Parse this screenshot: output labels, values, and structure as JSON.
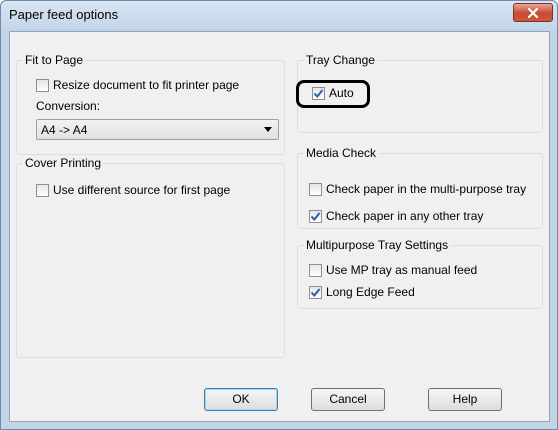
{
  "window": {
    "title": "Paper feed options"
  },
  "fit_to_page": {
    "title": "Fit to Page",
    "resize_label": "Resize document to fit printer page",
    "resize_checked": false,
    "conversion_label": "Conversion:",
    "conversion_value": "A4 -> A4"
  },
  "cover_printing": {
    "title": "Cover Printing",
    "diff_source_label": "Use different source for first page",
    "diff_source_checked": false
  },
  "tray_change": {
    "title": "Tray Change",
    "auto_label": "Auto",
    "auto_checked": true
  },
  "media_check": {
    "title": "Media Check",
    "mp_tray_label": "Check paper in the multi-purpose tray",
    "mp_tray_checked": false,
    "other_tray_label": "Check paper in any other tray",
    "other_tray_checked": true
  },
  "mp_tray_settings": {
    "title": "Multipurpose Tray Settings",
    "manual_feed_label": "Use MP tray as manual feed",
    "manual_feed_checked": false,
    "long_edge_label": "Long Edge Feed",
    "long_edge_checked": true
  },
  "buttons": {
    "ok": "OK",
    "cancel": "Cancel",
    "help": "Help"
  },
  "colors": {
    "check_blue": "#2a5cae",
    "close_red": "#c74a32"
  }
}
